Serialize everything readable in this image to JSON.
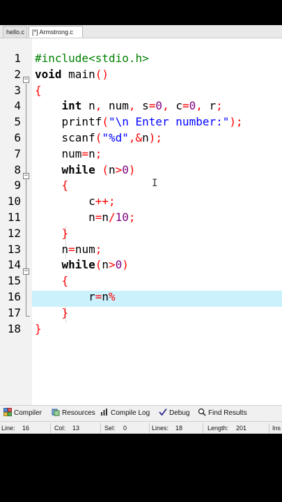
{
  "tabs": [
    {
      "label": "hello.c",
      "active": false
    },
    {
      "label": "[*] Armstrong.c",
      "active": true
    }
  ],
  "editor": {
    "line_numbers": [
      "1",
      "2",
      "3",
      "4",
      "5",
      "6",
      "7",
      "8",
      "9",
      "10",
      "11",
      "12",
      "13",
      "14",
      "15",
      "16",
      "17",
      "18"
    ],
    "current_line": "16",
    "lines": [
      [
        {
          "t": "#include<stdio.h>",
          "c": "pp"
        }
      ],
      [
        {
          "t": "void",
          "c": "kw"
        },
        {
          "t": " main",
          "c": "fn"
        },
        {
          "t": "()",
          "c": "op"
        }
      ],
      [
        {
          "t": "{",
          "c": "op"
        }
      ],
      [
        {
          "t": "    "
        },
        {
          "t": "int",
          "c": "kw"
        },
        {
          "t": " n"
        },
        {
          "t": ",",
          "c": "op"
        },
        {
          "t": " num"
        },
        {
          "t": ",",
          "c": "op"
        },
        {
          "t": " s"
        },
        {
          "t": "=",
          "c": "op"
        },
        {
          "t": "0",
          "c": "num"
        },
        {
          "t": ",",
          "c": "op"
        },
        {
          "t": " c"
        },
        {
          "t": "=",
          "c": "op"
        },
        {
          "t": "0",
          "c": "num"
        },
        {
          "t": ",",
          "c": "op"
        },
        {
          "t": " r"
        },
        {
          "t": ";",
          "c": "op"
        }
      ],
      [
        {
          "t": "    printf"
        },
        {
          "t": "(",
          "c": "op"
        },
        {
          "t": "\"\\n Enter number:\"",
          "c": "str"
        },
        {
          "t": ");",
          "c": "op"
        }
      ],
      [
        {
          "t": "    scanf"
        },
        {
          "t": "(",
          "c": "op"
        },
        {
          "t": "\"%d\"",
          "c": "str"
        },
        {
          "t": ",&",
          "c": "op"
        },
        {
          "t": "n"
        },
        {
          "t": ");",
          "c": "op"
        }
      ],
      [
        {
          "t": "    num"
        },
        {
          "t": "=",
          "c": "op"
        },
        {
          "t": "n"
        },
        {
          "t": ";",
          "c": "op"
        }
      ],
      [
        {
          "t": "    "
        },
        {
          "t": "while",
          "c": "kw"
        },
        {
          "t": " "
        },
        {
          "t": "(",
          "c": "op"
        },
        {
          "t": "n"
        },
        {
          "t": ">",
          "c": "op"
        },
        {
          "t": "0",
          "c": "num"
        },
        {
          "t": ")",
          "c": "op"
        }
      ],
      [
        {
          "t": "    "
        },
        {
          "t": "{",
          "c": "op"
        }
      ],
      [
        {
          "t": "        c"
        },
        {
          "t": "++;",
          "c": "op"
        }
      ],
      [
        {
          "t": "        n"
        },
        {
          "t": "=",
          "c": "op"
        },
        {
          "t": "n"
        },
        {
          "t": "/",
          "c": "op"
        },
        {
          "t": "10",
          "c": "num"
        },
        {
          "t": ";",
          "c": "op"
        }
      ],
      [
        {
          "t": "    "
        },
        {
          "t": "}",
          "c": "op"
        }
      ],
      [
        {
          "t": "    n"
        },
        {
          "t": "=",
          "c": "op"
        },
        {
          "t": "num"
        },
        {
          "t": ";",
          "c": "op"
        }
      ],
      [
        {
          "t": "    "
        },
        {
          "t": "while",
          "c": "kw"
        },
        {
          "t": "(",
          "c": "op"
        },
        {
          "t": "n"
        },
        {
          "t": ">",
          "c": "op"
        },
        {
          "t": "0",
          "c": "num"
        },
        {
          "t": ")",
          "c": "op"
        }
      ],
      [
        {
          "t": "    "
        },
        {
          "t": "{",
          "c": "op"
        }
      ],
      [
        {
          "t": "        r"
        },
        {
          "t": "=",
          "c": "op"
        },
        {
          "t": "n"
        },
        {
          "t": "%",
          "c": "op"
        }
      ],
      [
        {
          "t": "    "
        },
        {
          "t": "}",
          "c": "op"
        }
      ],
      [
        {
          "t": "}",
          "c": "op"
        }
      ]
    ],
    "colors": {
      "preprocessor": "#008000",
      "string": "#0000ff",
      "number": "#800080",
      "operator": "#ff0000",
      "current_line_bg": "#cbf1fd"
    }
  },
  "panel_tabs": [
    {
      "label": "Compiler",
      "icon": "compiler-grid-icon"
    },
    {
      "label": "Resources",
      "icon": "resources-icon"
    },
    {
      "label": "Compile Log",
      "icon": "compile-log-chart-icon"
    },
    {
      "label": "Debug",
      "icon": "debug-check-icon"
    },
    {
      "label": "Find Results",
      "icon": "find-results-icon"
    }
  ],
  "status": {
    "line_label": "Line:",
    "line_value": "16",
    "col_label": "Col:",
    "col_value": "13",
    "sel_label": "Sel:",
    "sel_value": "0",
    "lines_label": "Lines:",
    "lines_value": "18",
    "length_label": "Length:",
    "length_value": "201",
    "mode": "Ins"
  }
}
